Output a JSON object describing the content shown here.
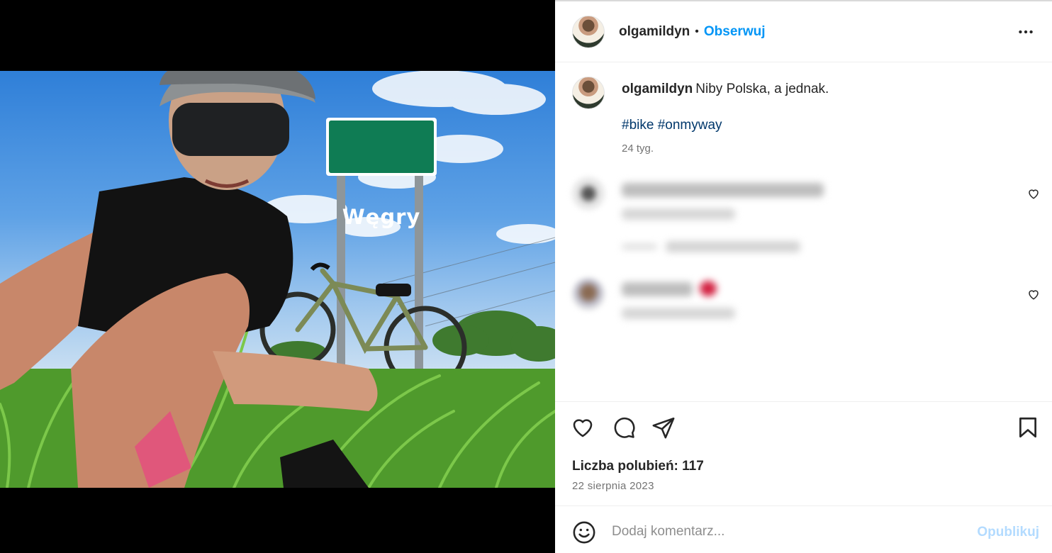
{
  "photo": {
    "sign_text": "Węgry"
  },
  "post": {
    "username": "olgamildyn",
    "follow_label": "Obserwuj",
    "separator": "•",
    "caption_text": "Niby Polska, a jednak.",
    "hashtags": [
      "#bike",
      "#onmyway"
    ],
    "posted_ago": "24 tyg.",
    "likes_label": "Liczba polubień: 117",
    "date": "22 sierpnia 2023"
  },
  "comment_box": {
    "placeholder": "Dodaj komentarz...",
    "publish_label": "Opublikuj"
  },
  "icons": {
    "more": "more-icon",
    "like": "heart-icon",
    "comment": "comment-icon",
    "share": "send-icon",
    "save": "bookmark-icon",
    "emoji": "emoji-icon"
  },
  "colors": {
    "link_blue": "#0095f6",
    "hashtag": "#00376b",
    "publish_disabled": "#b3dbff",
    "sign_green": "#0f7c54"
  }
}
